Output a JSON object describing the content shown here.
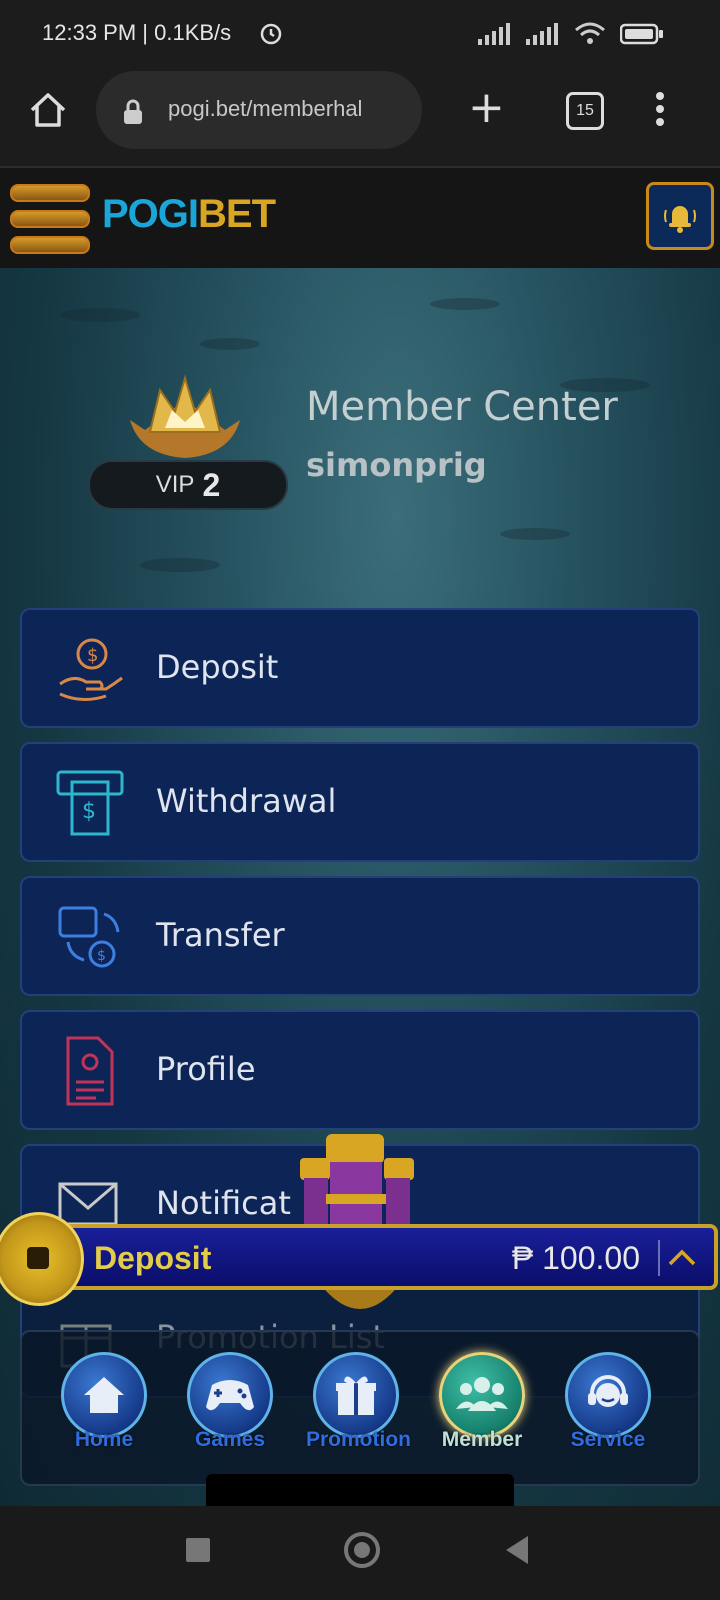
{
  "status_bar": {
    "time": "12:33 PM | 0.1KB/s"
  },
  "browser": {
    "url": "pogi.bet/memberhal",
    "tab_count": "15"
  },
  "site": {
    "logo_part1": "POGI",
    "logo_part2": "BET"
  },
  "profile": {
    "title": "Member Center",
    "username": "simonprig",
    "vip_label": "VIP",
    "vip_level": "2"
  },
  "menu": [
    {
      "label": "Deposit",
      "icon": "hand-coin-icon"
    },
    {
      "label": "Withdrawal",
      "icon": "atm-cash-icon"
    },
    {
      "label": "Transfer",
      "icon": "wallet-transfer-icon"
    },
    {
      "label": "Profile",
      "icon": "document-profile-icon"
    },
    {
      "label": "Notificat",
      "icon": "envelope-icon"
    },
    {
      "label": "Promotion List",
      "icon": "gift-icon"
    }
  ],
  "deposit_bar": {
    "label": "Deposit",
    "amount": "₱ 100.00"
  },
  "bottom_nav": [
    {
      "label": "Home",
      "icon": "home-icon"
    },
    {
      "label": "Games",
      "icon": "gamepad-icon"
    },
    {
      "label": "Promotion",
      "icon": "gift-icon"
    },
    {
      "label": "Member",
      "icon": "members-icon",
      "active": true
    },
    {
      "label": "Service",
      "icon": "headset-icon"
    }
  ],
  "colors": {
    "brand_blue": "#1aa6d8",
    "brand_gold": "#d9a623",
    "card_bg": "#0d2556"
  }
}
